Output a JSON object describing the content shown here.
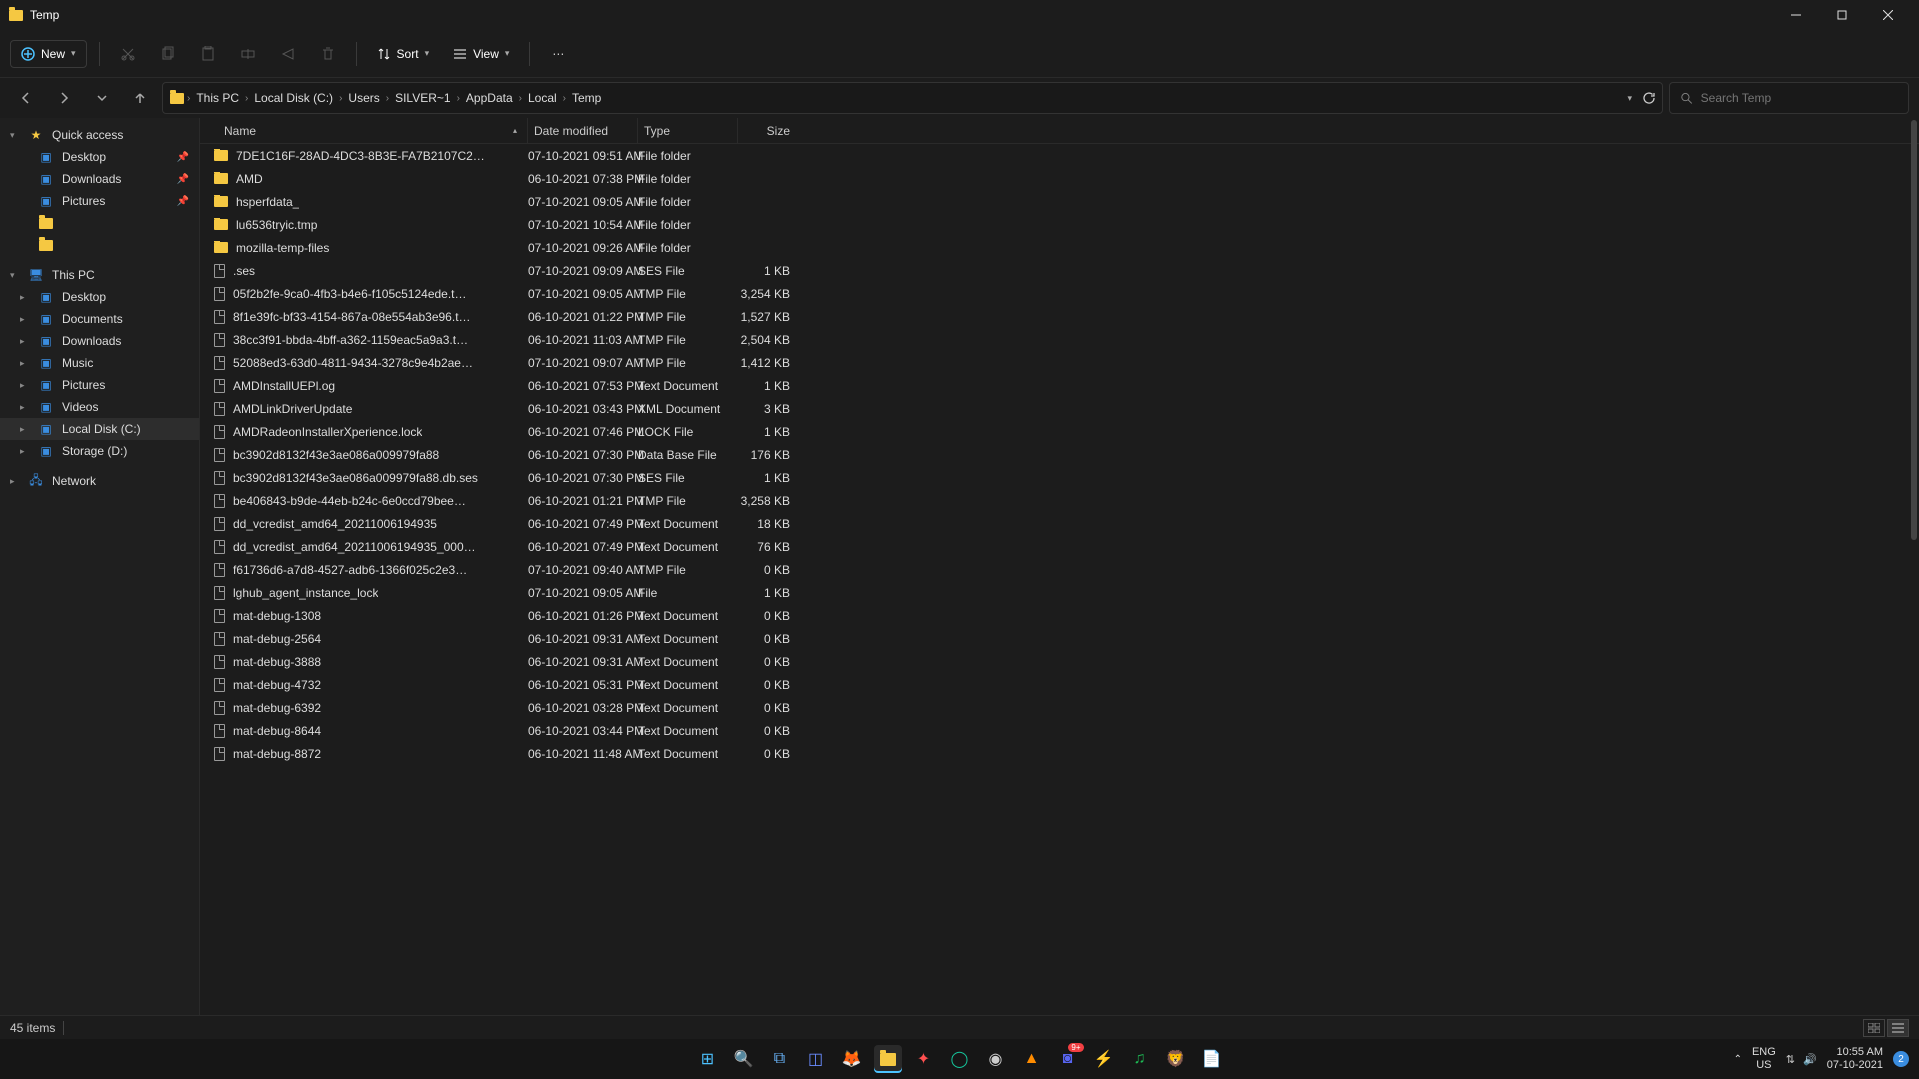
{
  "window": {
    "title": "Temp"
  },
  "toolbar": {
    "new_label": "New",
    "sort_label": "Sort",
    "view_label": "View"
  },
  "breadcrumbs": [
    "This PC",
    "Local Disk (C:)",
    "Users",
    "SILVER~1",
    "AppData",
    "Local",
    "Temp"
  ],
  "search": {
    "placeholder": "Search Temp"
  },
  "sidebar": {
    "quick_access": "Quick access",
    "quick_items": [
      {
        "label": "Desktop",
        "pinned": true
      },
      {
        "label": "Downloads",
        "pinned": true
      },
      {
        "label": "Pictures",
        "pinned": true
      }
    ],
    "this_pc": "This PC",
    "pc_items": [
      {
        "label": "Desktop"
      },
      {
        "label": "Documents"
      },
      {
        "label": "Downloads"
      },
      {
        "label": "Music"
      },
      {
        "label": "Pictures"
      },
      {
        "label": "Videos"
      },
      {
        "label": "Local Disk (C:)",
        "selected": true
      },
      {
        "label": "Storage (D:)"
      }
    ],
    "network": "Network"
  },
  "columns": {
    "name": "Name",
    "date": "Date modified",
    "type": "Type",
    "size": "Size"
  },
  "files": [
    {
      "name": "7DE1C16F-28AD-4DC3-8B3E-FA7B2107C2…",
      "date": "07-10-2021 09:51 AM",
      "type": "File folder",
      "size": "",
      "kind": "folder"
    },
    {
      "name": "AMD",
      "date": "06-10-2021 07:38 PM",
      "type": "File folder",
      "size": "",
      "kind": "folder"
    },
    {
      "name": "hsperfdata_",
      "date": "07-10-2021 09:05 AM",
      "type": "File folder",
      "size": "",
      "kind": "folder"
    },
    {
      "name": "lu6536tryic.tmp",
      "date": "07-10-2021 10:54 AM",
      "type": "File folder",
      "size": "",
      "kind": "folder"
    },
    {
      "name": "mozilla-temp-files",
      "date": "07-10-2021 09:26 AM",
      "type": "File folder",
      "size": "",
      "kind": "folder"
    },
    {
      "name": ".ses",
      "date": "07-10-2021 09:09 AM",
      "type": "SES File",
      "size": "1 KB",
      "kind": "file"
    },
    {
      "name": "05f2b2fe-9ca0-4fb3-b4e6-f105c5124ede.t…",
      "date": "07-10-2021 09:05 AM",
      "type": "TMP File",
      "size": "3,254 KB",
      "kind": "file"
    },
    {
      "name": "8f1e39fc-bf33-4154-867a-08e554ab3e96.t…",
      "date": "06-10-2021 01:22 PM",
      "type": "TMP File",
      "size": "1,527 KB",
      "kind": "file"
    },
    {
      "name": "38cc3f91-bbda-4bff-a362-1159eac5a9a3.t…",
      "date": "06-10-2021 11:03 AM",
      "type": "TMP File",
      "size": "2,504 KB",
      "kind": "file"
    },
    {
      "name": "52088ed3-63d0-4811-9434-3278c9e4b2ae…",
      "date": "07-10-2021 09:07 AM",
      "type": "TMP File",
      "size": "1,412 KB",
      "kind": "file"
    },
    {
      "name": "AMDInstallUEPl.og",
      "date": "06-10-2021 07:53 PM",
      "type": "Text Document",
      "size": "1 KB",
      "kind": "file"
    },
    {
      "name": "AMDLinkDriverUpdate",
      "date": "06-10-2021 03:43 PM",
      "type": "XML Document",
      "size": "3 KB",
      "kind": "file"
    },
    {
      "name": "AMDRadeonInstallerXperience.lock",
      "date": "06-10-2021 07:46 PM",
      "type": "LOCK File",
      "size": "1 KB",
      "kind": "file"
    },
    {
      "name": "bc3902d8132f43e3ae086a009979fa88",
      "date": "06-10-2021 07:30 PM",
      "type": "Data Base File",
      "size": "176 KB",
      "kind": "file"
    },
    {
      "name": "bc3902d8132f43e3ae086a009979fa88.db.ses",
      "date": "06-10-2021 07:30 PM",
      "type": "SES File",
      "size": "1 KB",
      "kind": "file"
    },
    {
      "name": "be406843-b9de-44eb-b24c-6e0ccd79bee…",
      "date": "06-10-2021 01:21 PM",
      "type": "TMP File",
      "size": "3,258 KB",
      "kind": "file"
    },
    {
      "name": "dd_vcredist_amd64_20211006194935",
      "date": "06-10-2021 07:49 PM",
      "type": "Text Document",
      "size": "18 KB",
      "kind": "file"
    },
    {
      "name": "dd_vcredist_amd64_20211006194935_000…",
      "date": "06-10-2021 07:49 PM",
      "type": "Text Document",
      "size": "76 KB",
      "kind": "file"
    },
    {
      "name": "f61736d6-a7d8-4527-adb6-1366f025c2e3…",
      "date": "07-10-2021 09:40 AM",
      "type": "TMP File",
      "size": "0 KB",
      "kind": "file"
    },
    {
      "name": "lghub_agent_instance_lock",
      "date": "07-10-2021 09:05 AM",
      "type": "File",
      "size": "1 KB",
      "kind": "file"
    },
    {
      "name": "mat-debug-1308",
      "date": "06-10-2021 01:26 PM",
      "type": "Text Document",
      "size": "0 KB",
      "kind": "file"
    },
    {
      "name": "mat-debug-2564",
      "date": "06-10-2021 09:31 AM",
      "type": "Text Document",
      "size": "0 KB",
      "kind": "file"
    },
    {
      "name": "mat-debug-3888",
      "date": "06-10-2021 09:31 AM",
      "type": "Text Document",
      "size": "0 KB",
      "kind": "file"
    },
    {
      "name": "mat-debug-4732",
      "date": "06-10-2021 05:31 PM",
      "type": "Text Document",
      "size": "0 KB",
      "kind": "file"
    },
    {
      "name": "mat-debug-6392",
      "date": "06-10-2021 03:28 PM",
      "type": "Text Document",
      "size": "0 KB",
      "kind": "file"
    },
    {
      "name": "mat-debug-8644",
      "date": "06-10-2021 03:44 PM",
      "type": "Text Document",
      "size": "0 KB",
      "kind": "file"
    },
    {
      "name": "mat-debug-8872",
      "date": "06-10-2021 11:48 AM",
      "type": "Text Document",
      "size": "0 KB",
      "kind": "file"
    }
  ],
  "status": {
    "count": "45 items"
  },
  "taskbar": {
    "lang1": "ENG",
    "lang2": "US",
    "time": "10:55 AM",
    "date": "07-10-2021",
    "notif_count": "2"
  }
}
